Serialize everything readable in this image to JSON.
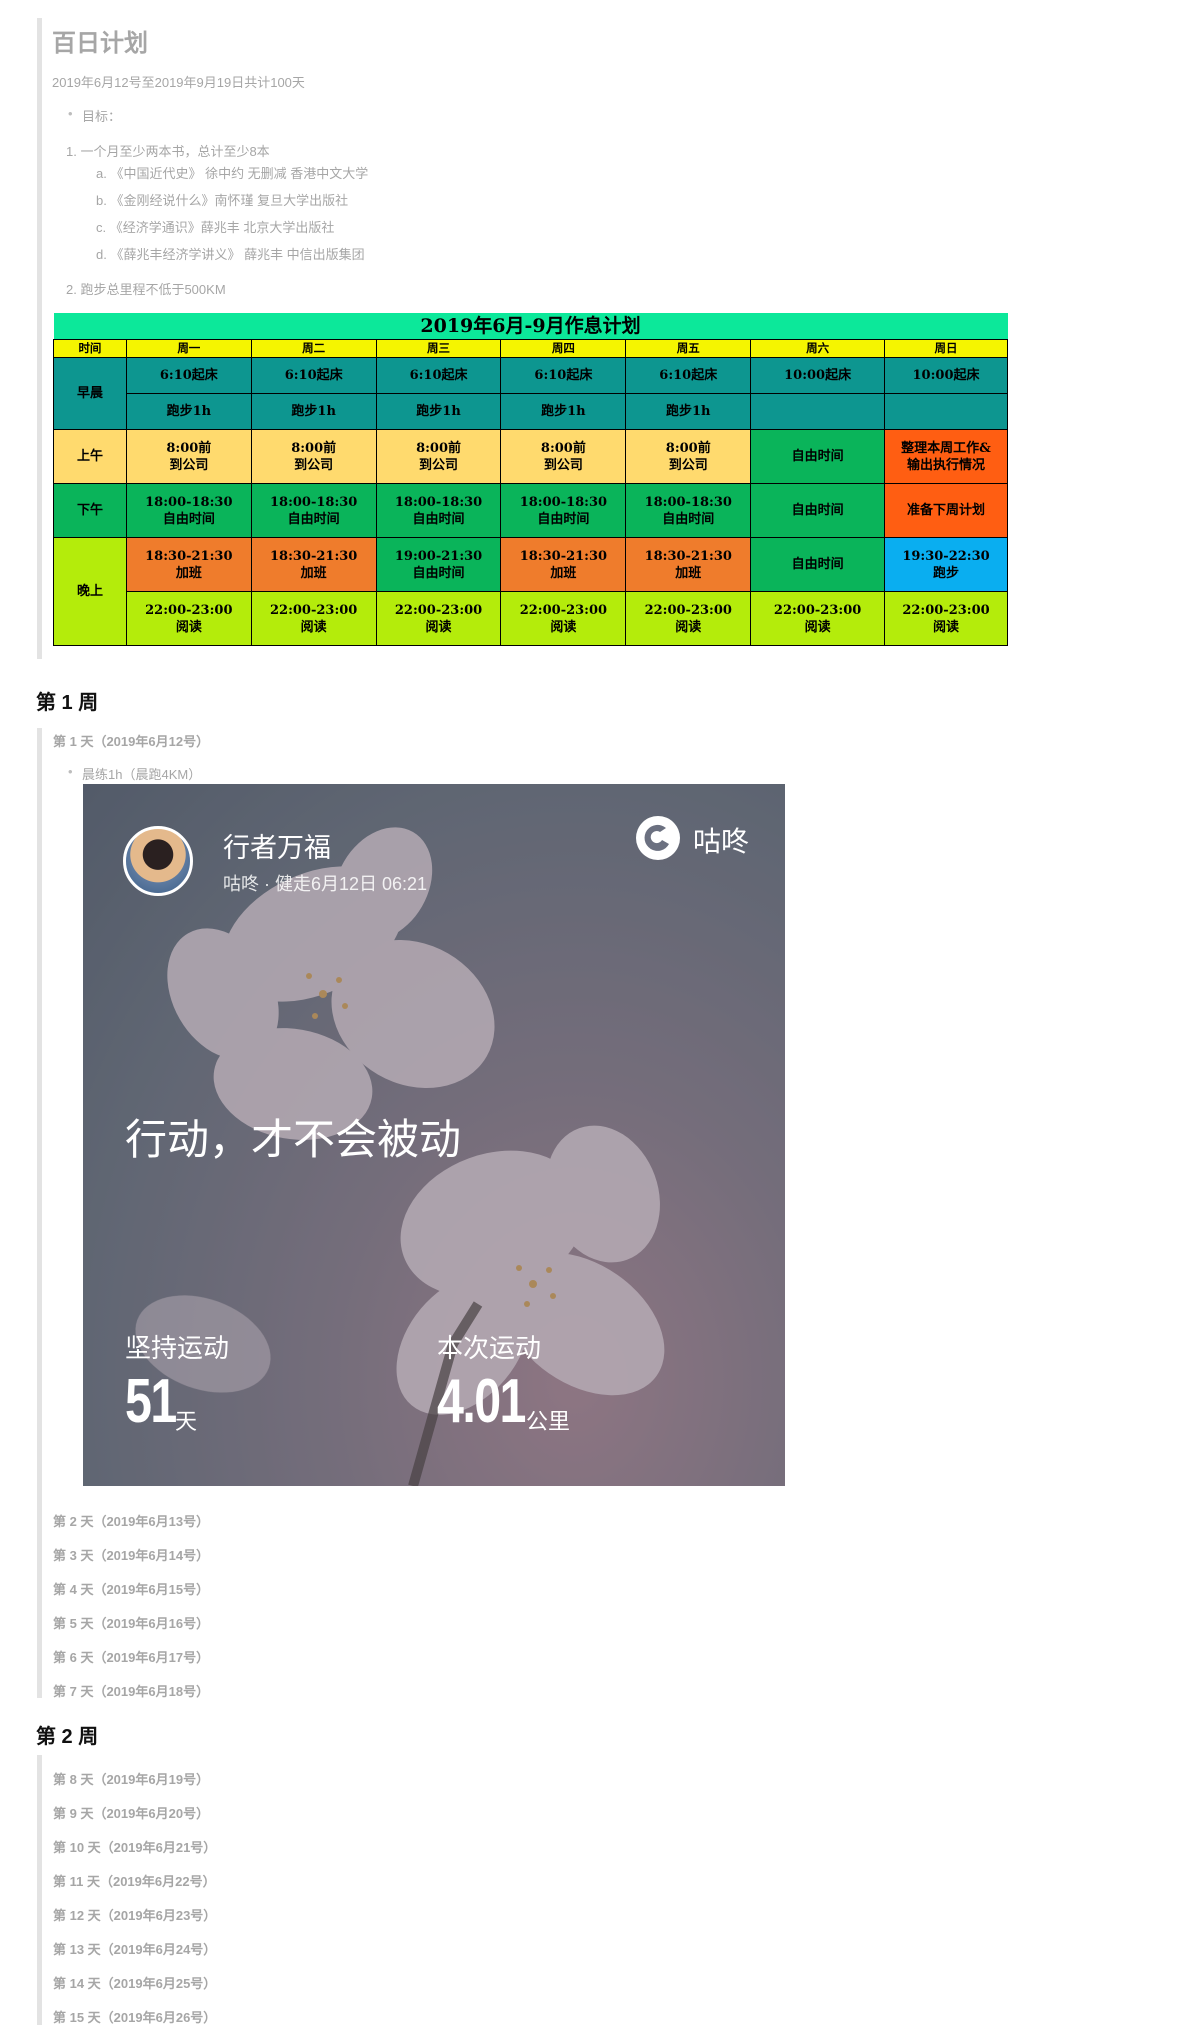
{
  "header": {
    "title": "百日计划",
    "subtitle": "2019年6月12号至2019年9月19日共计100天"
  },
  "goals": {
    "label": "目标：",
    "items": [
      {
        "text": "1. 一个月至少两本书，总计至少8本",
        "books": [
          "a. 《中国近代史》 徐中约 无删减 香港中文大学",
          "b. 《金刚经说什么》南怀瑾 复旦大学出版社",
          "c. 《经济学通识》薛兆丰 北京大学出版社",
          "d. 《薛兆丰经济学讲义》 薛兆丰 中信出版集团"
        ]
      },
      {
        "text": "2. 跑步总里程不低于500KM"
      }
    ]
  },
  "schedule": {
    "title": "2019年6月-9月作息计划",
    "headers": [
      "时间",
      "周一",
      "周二",
      "周三",
      "周四",
      "周五",
      "周六",
      "周日"
    ],
    "periods": [
      "早晨",
      "上午",
      "下午",
      "晚上"
    ],
    "rows": {
      "morning1": [
        "6:10起床",
        "6:10起床",
        "6:10起床",
        "6:10起床",
        "6:10起床",
        "10:00起床",
        "10:00起床"
      ],
      "morning2": [
        "跑步1h",
        "跑步1h",
        "跑步1h",
        "跑步1h",
        "跑步1h",
        "",
        ""
      ],
      "forenoon": [
        "8:00前\n到公司",
        "8:00前\n到公司",
        "8:00前\n到公司",
        "8:00前\n到公司",
        "8:00前\n到公司",
        "自由时间",
        "整理本周工作&\n输出执行情况"
      ],
      "afternoon": [
        "18:00-18:30\n自由时间",
        "18:00-18:30\n自由时间",
        "18:00-18:30\n自由时间",
        "18:00-18:30\n自由时间",
        "18:00-18:30\n自由时间",
        "自由时间",
        "准备下周计划"
      ],
      "evening1": [
        "18:30-21:30\n加班",
        "18:30-21:30\n加班",
        "19:00-21:30\n自由时间",
        "18:30-21:30\n加班",
        "18:30-21:30\n加班",
        "自由时间",
        "19:30-22:30\n跑步"
      ],
      "evening2": [
        "22:00-23:00\n阅读",
        "22:00-23:00\n阅读",
        "22:00-23:00\n阅读",
        "22:00-23:00\n阅读",
        "22:00-23:00\n阅读",
        "22:00-23:00\n阅读",
        "22:00-23:00\n阅读"
      ]
    },
    "colors": {
      "title": "#0ce89a",
      "header": "#f5f500",
      "teal": "#0d9690",
      "yellow": "#ffda6e",
      "green": "#0ab45a",
      "orange": "#ef7c2c",
      "red": "#ff5e12",
      "lime": "#b4ec0b",
      "blue": "#0aaef0"
    }
  },
  "week1": {
    "heading": "第 1 周",
    "day1": "第 1 天（2019年6月12号）",
    "day1_bullet": "晨练1h（晨跑4KM）",
    "card": {
      "username": "行者万福",
      "meta": "咕咚 · 健走6月12日 06:21",
      "brand": "咕咚",
      "slogan": "行动，才不会被动",
      "stat1_label": "坚持运动",
      "stat1_value": "51",
      "stat1_unit": "天",
      "stat2_label": "本次运动",
      "stat2_value": "4.01",
      "stat2_unit": "公里"
    },
    "days": [
      "第 2 天（2019年6月13号）",
      "第 3 天（2019年6月14号）",
      "第 4 天（2019年6月15号）",
      "第 5 天（2019年6月16号）",
      "第 6 天（2019年6月17号）",
      "第 7 天（2019年6月18号）"
    ]
  },
  "week2": {
    "heading": "第 2 周",
    "days": [
      "第 8 天（2019年6月19号）",
      "第 9 天（2019年6月20号）",
      "第 10 天（2019年6月21号）",
      "第 11 天（2019年6月22号）",
      "第 12 天（2019年6月23号）",
      "第 13 天（2019年6月24号）",
      "第 14 天（2019年6月25号）",
      "第 15 天（2019年6月26号）"
    ]
  }
}
